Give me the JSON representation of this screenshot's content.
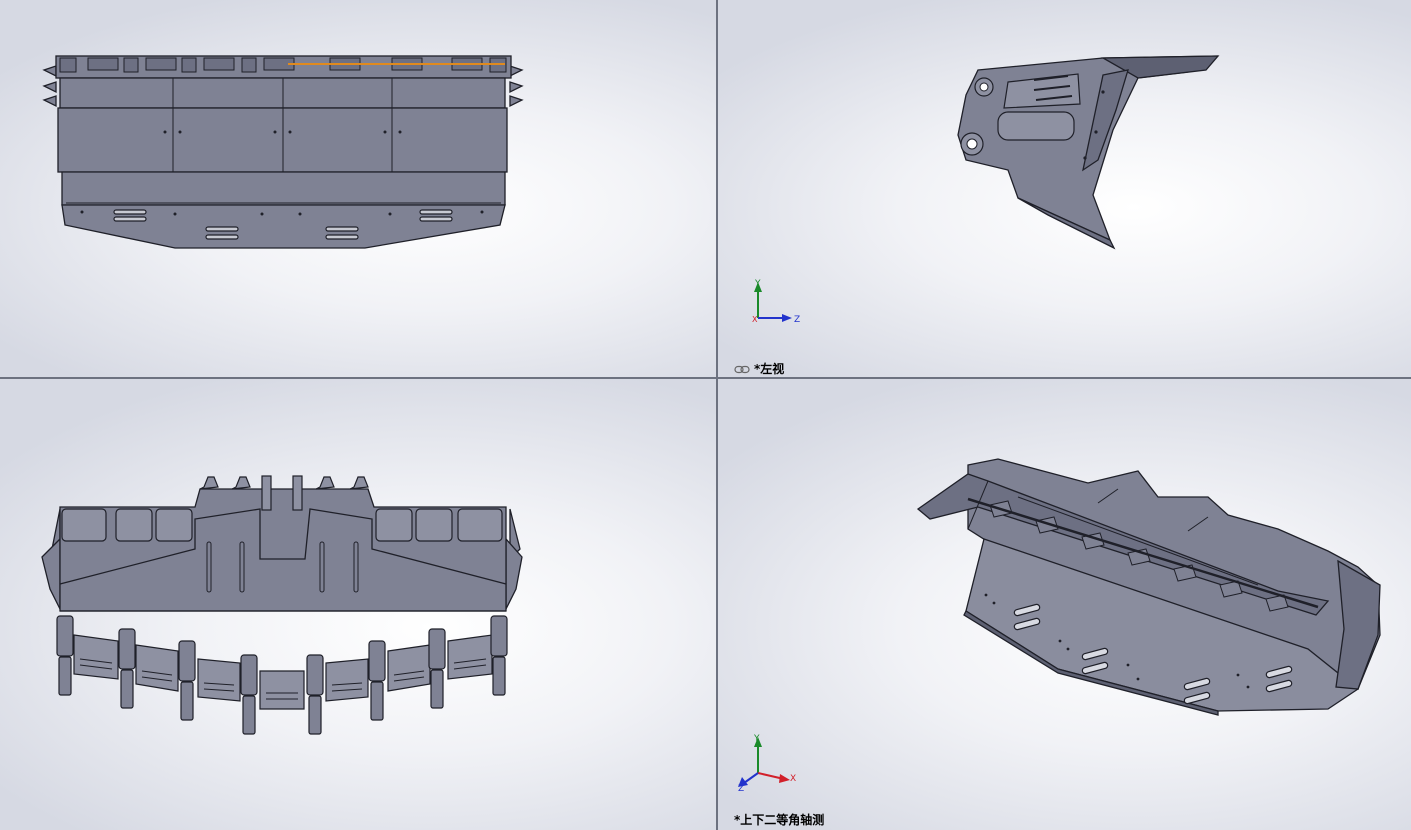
{
  "viewports": {
    "top_left": {
      "label": ""
    },
    "top_right": {
      "label": "*左视",
      "linked": true,
      "triad": {
        "y": "Y",
        "z": "Z",
        "x": "X"
      }
    },
    "bottom_left": {
      "label": ""
    },
    "bottom_right": {
      "label": "*上下二等角轴测",
      "triad": {
        "y": "Y",
        "z": "Z",
        "x": "X"
      }
    }
  },
  "colors": {
    "part_fill": "#7f8294",
    "part_fill_dark": "#5d6072",
    "edge": "#1f2029",
    "highlight": "#e08a1e",
    "axis_x": "#d2202a",
    "axis_y": "#1a8a2a",
    "axis_z": "#2233cc"
  }
}
